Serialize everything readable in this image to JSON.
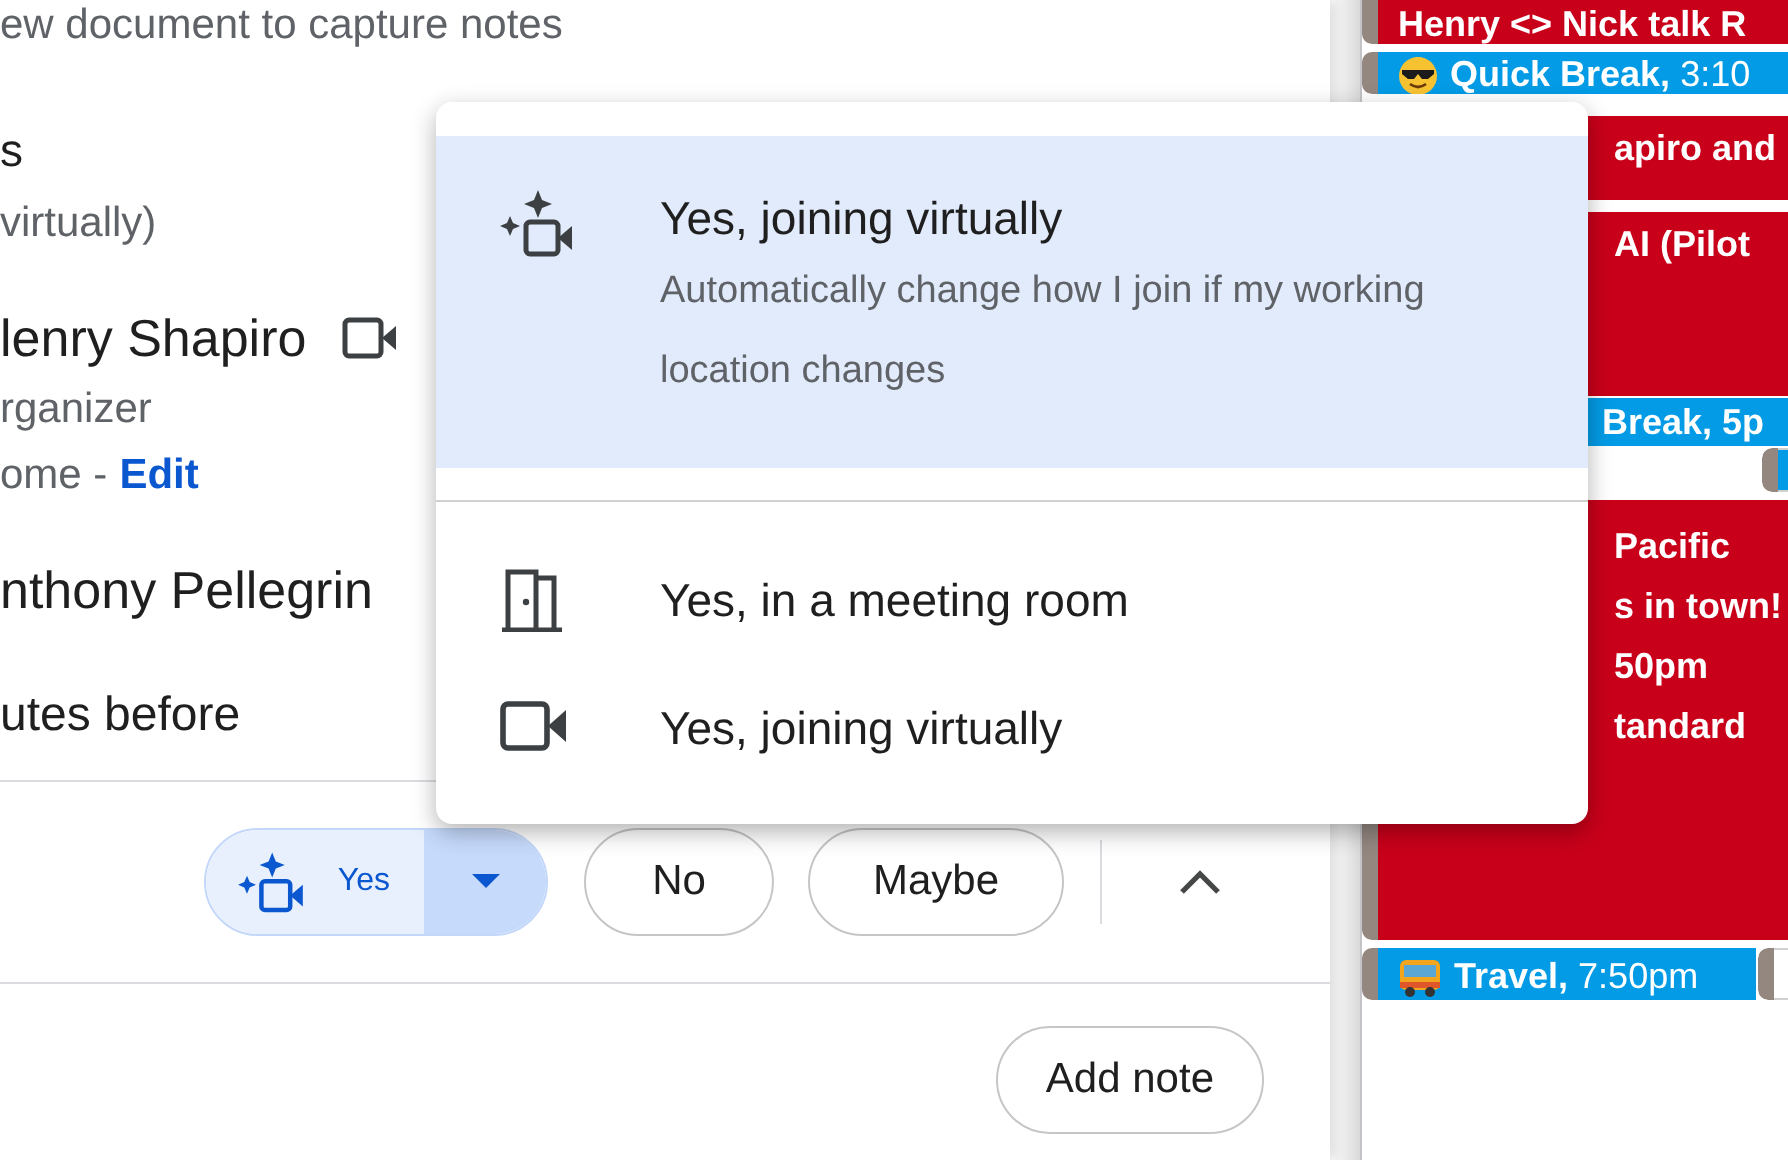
{
  "details": {
    "notes_hint": "ew document to capture notes",
    "rsvp_heading": "s",
    "rsvp_status": "virtually)",
    "guests": [
      {
        "name": "lenry Shapiro",
        "role": "rganizer",
        "location": "ome -",
        "location_link": "Edit"
      },
      {
        "name": "nthony Pellegrin"
      }
    ],
    "reminder": "utes before"
  },
  "rsvp": {
    "options": [
      {
        "label": "Yes",
        "selected": true
      },
      {
        "label": "No",
        "selected": false
      },
      {
        "label": "Maybe",
        "selected": false
      }
    ]
  },
  "add_note": "Add note",
  "menu": {
    "items": [
      {
        "kind": "auto",
        "label": "Yes, joining virtually",
        "description": "Automatically change how I join if my working location changes",
        "selected": true
      },
      {
        "kind": "room",
        "label": "Yes, in a meeting room",
        "selected": false
      },
      {
        "kind": "virtual",
        "label": "Yes, joining virtually",
        "selected": false
      }
    ]
  },
  "calendar": {
    "events": [
      {
        "kind": "event",
        "color": "#c9001a",
        "lines": [
          "Henry <> Nick talk R"
        ]
      },
      {
        "kind": "break",
        "color": "#039be5",
        "lines": [
          "**Quick Break,** 3:10"
        ]
      },
      {
        "kind": "event",
        "color": "#c9001a",
        "lines": [
          "apiro and"
        ]
      },
      {
        "kind": "event",
        "color": "#c9001a",
        "lines": [
          "AI (Pilot"
        ]
      },
      {
        "kind": "event",
        "color": "#039be5",
        "lines": [
          "**Break,** 5p"
        ]
      },
      {
        "kind": "sliver",
        "color": "#039be5"
      },
      {
        "kind": "event",
        "color": "#c9001a",
        "lines": [
          "Pacific",
          "s in town!",
          "50pm",
          "tandard"
        ]
      },
      {
        "kind": "travel",
        "color": "#039be5",
        "lines": [
          "**Travel,** 7:50pm"
        ]
      },
      {
        "kind": "sliver",
        "color": "#ffffff"
      }
    ]
  }
}
